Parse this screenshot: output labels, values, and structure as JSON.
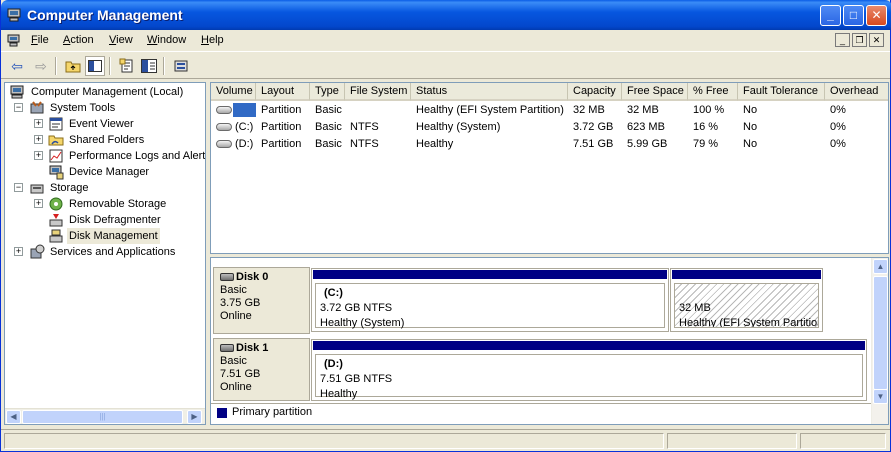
{
  "window": {
    "title": "Computer Management"
  },
  "menubar": {
    "items": [
      {
        "label": "File",
        "key": "F"
      },
      {
        "label": "Action",
        "key": "A"
      },
      {
        "label": "View",
        "key": "V"
      },
      {
        "label": "Window",
        "key": "W"
      },
      {
        "label": "Help",
        "key": "H"
      }
    ]
  },
  "tree": {
    "root": "Computer Management (Local)",
    "items": [
      {
        "label": "System Tools"
      },
      {
        "label": "Event Viewer"
      },
      {
        "label": "Shared Folders"
      },
      {
        "label": "Performance Logs and Alerts"
      },
      {
        "label": "Device Manager"
      },
      {
        "label": "Storage"
      },
      {
        "label": "Removable Storage"
      },
      {
        "label": "Disk Defragmenter"
      },
      {
        "label": "Disk Management"
      },
      {
        "label": "Services and Applications"
      }
    ],
    "selected": "Disk Management"
  },
  "volume_list": {
    "columns": [
      "Volume",
      "Layout",
      "Type",
      "File System",
      "Status",
      "Capacity",
      "Free Space",
      "% Free",
      "Fault Tolerance",
      "Overhead"
    ],
    "rows": [
      {
        "volume": "",
        "layout": "Partition",
        "type": "Basic",
        "fs": "",
        "status": "Healthy (EFI System Partition)",
        "capacity": "32 MB",
        "free": "32 MB",
        "pct": "100 %",
        "fault": "No",
        "overhead": "0%"
      },
      {
        "volume": "(C:)",
        "layout": "Partition",
        "type": "Basic",
        "fs": "NTFS",
        "status": "Healthy (System)",
        "capacity": "3.72 GB",
        "free": "623 MB",
        "pct": "16 %",
        "fault": "No",
        "overhead": "0%"
      },
      {
        "volume": "(D:)",
        "layout": "Partition",
        "type": "Basic",
        "fs": "NTFS",
        "status": "Healthy",
        "capacity": "7.51 GB",
        "free": "5.99 GB",
        "pct": "79 %",
        "fault": "No",
        "overhead": "0%"
      }
    ]
  },
  "disks": [
    {
      "name": "Disk 0",
      "type": "Basic",
      "size": "3.75 GB",
      "state": "Online",
      "partitions": [
        {
          "name": "(C:)",
          "size": "3.72 GB NTFS",
          "status": "Healthy (System)"
        },
        {
          "name": "",
          "size": "32 MB",
          "status": "Healthy (EFI System Partition)"
        }
      ]
    },
    {
      "name": "Disk 1",
      "type": "Basic",
      "size": "7.51 GB",
      "state": "Online",
      "partitions": [
        {
          "name": "(D:)",
          "size": "7.51 GB NTFS",
          "status": "Healthy"
        }
      ]
    }
  ],
  "legend": {
    "label": "Primary partition",
    "color": "#000084"
  },
  "colors": {
    "titlebar": "#0a5de6",
    "selection": "#316ac5",
    "partition_bar": "#000084"
  }
}
